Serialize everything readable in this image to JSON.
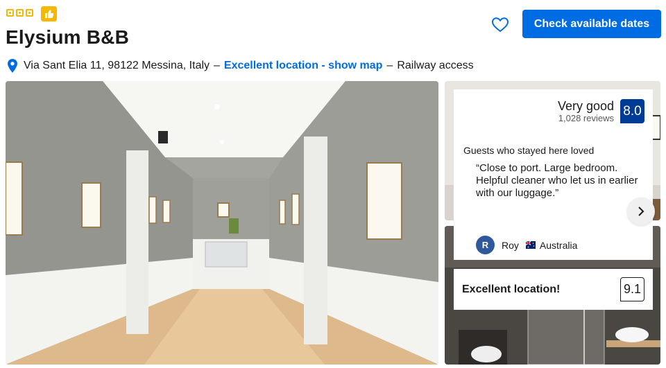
{
  "rating": {
    "stars": 3,
    "thumb_icon": "thumbs-up-icon"
  },
  "property": {
    "name": "Elysium B&B",
    "address": "Via Sant Elia 11, 98122 Messina, Italy",
    "separator": "–",
    "location_link": "Excellent location - show map",
    "extra": "Railway access"
  },
  "actions": {
    "cta_label": "Check available dates",
    "heart_icon": "heart-outline-icon"
  },
  "reviews": {
    "score_word": "Very good",
    "review_count": "1,028 reviews",
    "score": "8.0",
    "loved_title": "Guests who stayed here loved",
    "quote": "“Close to port. Large bedroom. Helpful cleaner who let us in earlier with our luggage.”",
    "reviewer_initial": "R",
    "reviewer_name": "Roy",
    "reviewer_country": "Australia"
  },
  "location_score": {
    "label": "Excellent location!",
    "score": "9.1"
  },
  "colors": {
    "brand_blue": "#006ce4",
    "score_navy": "#003b95",
    "star_yellow": "#f5b800"
  }
}
